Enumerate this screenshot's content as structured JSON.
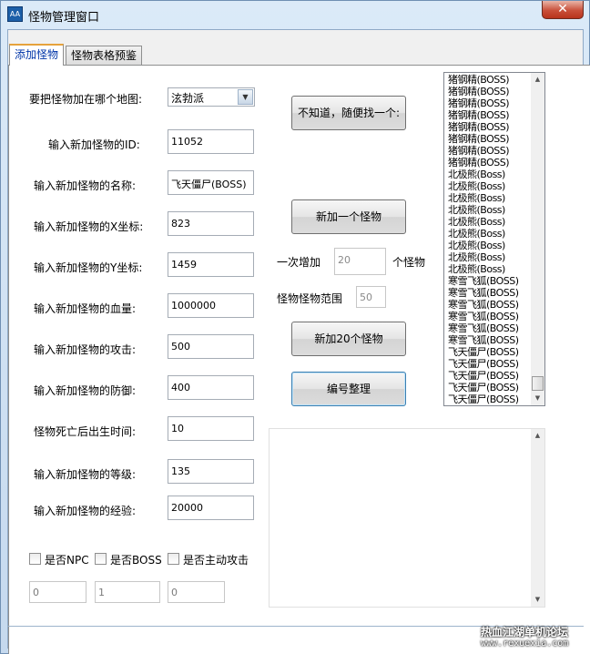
{
  "window": {
    "title": "怪物管理窗口",
    "icon": "app-icon"
  },
  "tabs": [
    {
      "label": "添加怪物",
      "active": true
    },
    {
      "label": "怪物表格预鉴",
      "active": false
    }
  ],
  "form": {
    "map_label": "要把怪物加在哪个地图:",
    "map_value": "泫勃派",
    "id_label": "输入新加怪物的ID:",
    "id_value": "11052",
    "name_label": "输入新加怪物的名称:",
    "name_value": "飞天僵尸(BOSS)",
    "x_label": "输入新加怪物的X坐标:",
    "x_value": "823",
    "y_label": "输入新加怪物的Y坐标:",
    "y_value": "1459",
    "hp_label": "输入新加怪物的血量:",
    "hp_value": "1000000",
    "atk_label": "输入新加怪物的攻击:",
    "atk_value": "500",
    "def_label": "输入新加怪物的防御:",
    "def_value": "400",
    "respawn_label": "怪物死亡后出生时间:",
    "respawn_value": "10",
    "level_label": "输入新加怪物的等级:",
    "level_value": "135",
    "exp_label": "输入新加怪物的经验:",
    "exp_value": "20000"
  },
  "buttons": {
    "random": "不知道，随便找一个:",
    "add_one": "新加一个怪物",
    "add_twenty": "新加20个怪物",
    "renumber": "编号整理"
  },
  "batch": {
    "once_add_label": "一次增加",
    "once_add_value": "20",
    "unit_label": "个怪物",
    "range_label": "怪物怪物范围",
    "range_value": "50"
  },
  "checkboxes": [
    {
      "label": "是否NPC",
      "checked": false
    },
    {
      "label": "是否BOSS",
      "checked": false
    },
    {
      "label": "是否主动攻击",
      "checked": false
    }
  ],
  "flags": [
    "0",
    "1",
    "0"
  ],
  "monster_list": [
    "猪钢精(BOSS)",
    "猪钢精(BOSS)",
    "猪钢精(BOSS)",
    "猪钢精(BOSS)",
    "猪钢精(BOSS)",
    "猪钢精(BOSS)",
    "猪钢精(BOSS)",
    "猪钢精(BOSS)",
    "北极熊(Boss)",
    "北极熊(Boss)",
    "北极熊(Boss)",
    "北极熊(Boss)",
    "北极熊(Boss)",
    "北极熊(Boss)",
    "北极熊(Boss)",
    "北极熊(Boss)",
    "北极熊(Boss)",
    "寒雪飞狐(BOSS)",
    "寒雪飞狐(BOSS)",
    "寒雪飞狐(BOSS)",
    "寒雪飞狐(BOSS)",
    "寒雪飞狐(BOSS)",
    "寒雪飞狐(BOSS)",
    "飞天僵尸(BOSS)",
    "飞天僵尸(BOSS)",
    "飞天僵尸(BOSS)",
    "飞天僵尸(BOSS)",
    "飞天僵尸(BOSS)",
    "飞天僵尸(BOSS)"
  ],
  "monster_list_selected_index": 28,
  "watermark": {
    "text": "热血江湖单机论坛",
    "url": "www.rexuexia.com"
  }
}
